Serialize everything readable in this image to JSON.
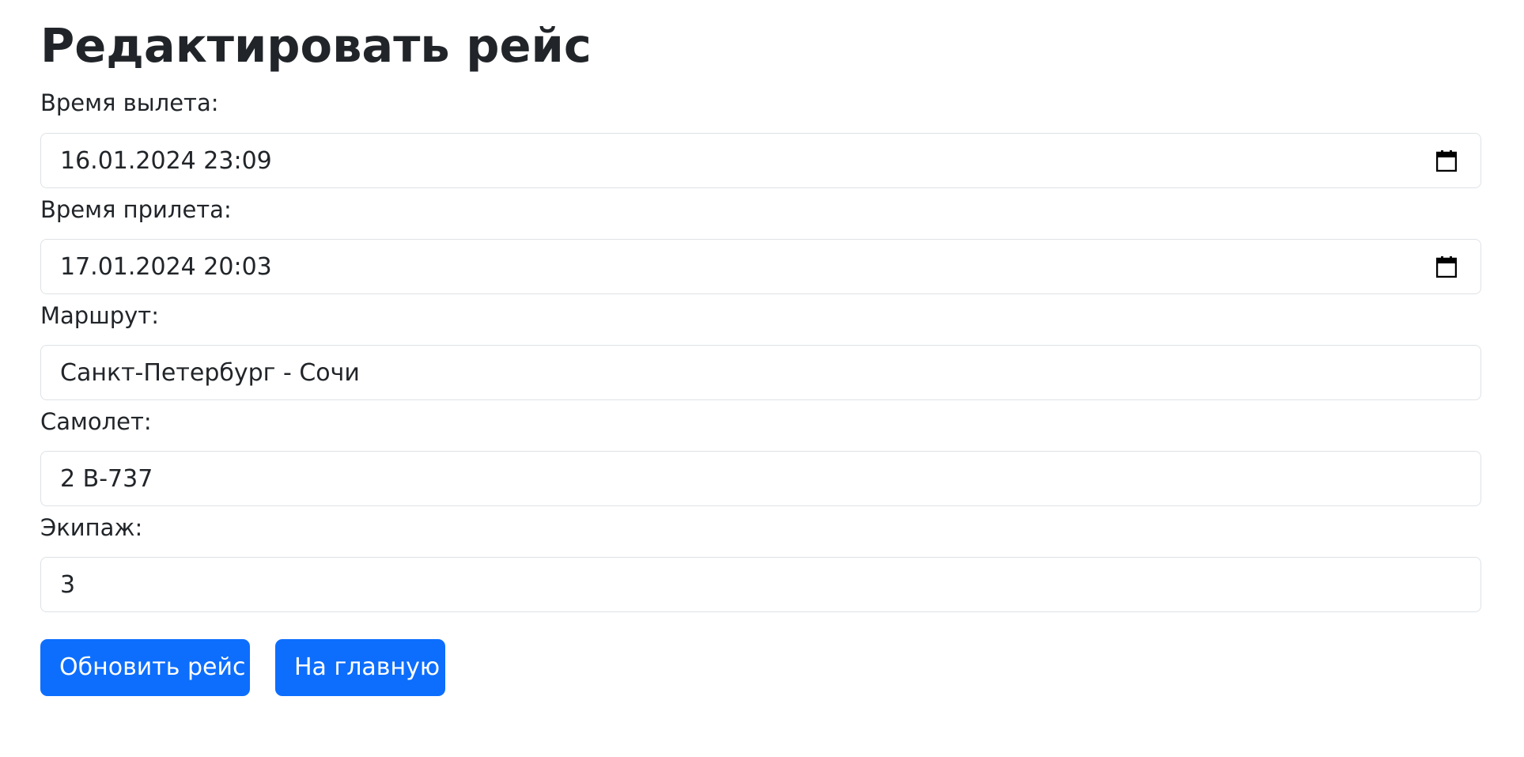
{
  "page": {
    "title": "Редактировать рейс"
  },
  "form": {
    "departure": {
      "label": "Время вылета:",
      "value": "16.01.2024 23:09"
    },
    "arrival": {
      "label": "Время прилета:",
      "value": "17.01.2024 20:03"
    },
    "route": {
      "label": "Маршрут:",
      "value": "Санкт-Петербург - Сочи"
    },
    "aircraft": {
      "label": "Самолет:",
      "value": "2 B-737"
    },
    "crew": {
      "label": "Экипаж:",
      "value": "3"
    }
  },
  "actions": {
    "update_label": "Обновить рейс",
    "home_label": "На главную"
  },
  "colors": {
    "primary": "#0d6efd",
    "text": "#212529",
    "border": "#dee2e6"
  },
  "icons": {
    "date_picker": "calendar-icon"
  }
}
